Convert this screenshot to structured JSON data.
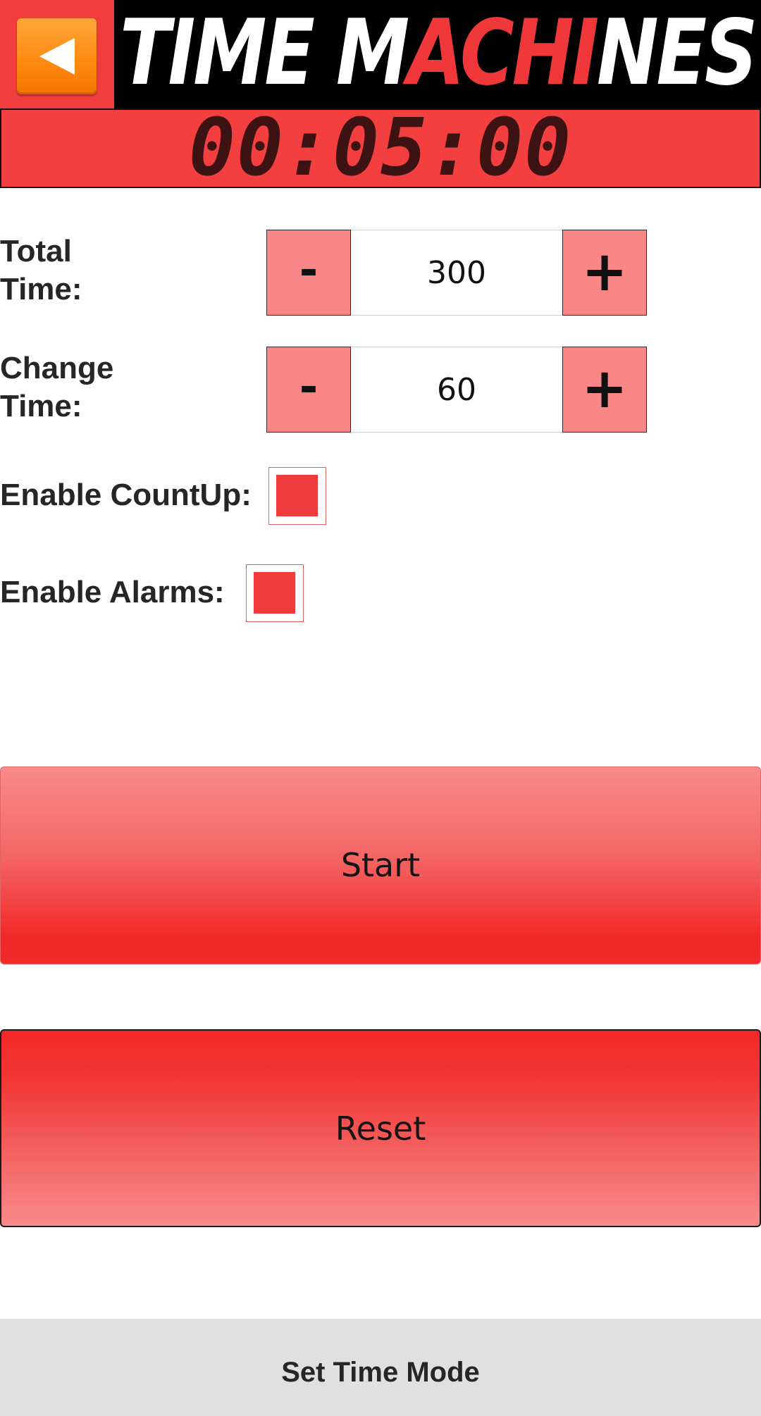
{
  "header": {
    "back_icon": "back-arrow-icon",
    "logo": {
      "part1": "TIME M",
      "part2": "ACHI",
      "part3": "NES",
      "white": "#ffffff",
      "red": "#f0383b"
    }
  },
  "timer": {
    "display": "00:05:00"
  },
  "total_time": {
    "label_line1": "Total",
    "label_line2": "Time:",
    "minus": "-",
    "value": "300",
    "plus": "+"
  },
  "change_time": {
    "label_line1": "Change",
    "label_line2": "Time:",
    "minus": "-",
    "value": "60",
    "plus": "+"
  },
  "countup": {
    "label": "Enable CountUp:",
    "checked": true
  },
  "alarms": {
    "label": "Enable Alarms:",
    "checked": true
  },
  "buttons": {
    "start": "Start",
    "reset": "Reset"
  },
  "bottom": {
    "label": "Set Time Mode"
  },
  "colors": {
    "accent_red": "#f43f41",
    "stepper_pink": "#f98787",
    "back_orange": "#ff8c12",
    "bottom_gray": "#e0e0e0"
  }
}
